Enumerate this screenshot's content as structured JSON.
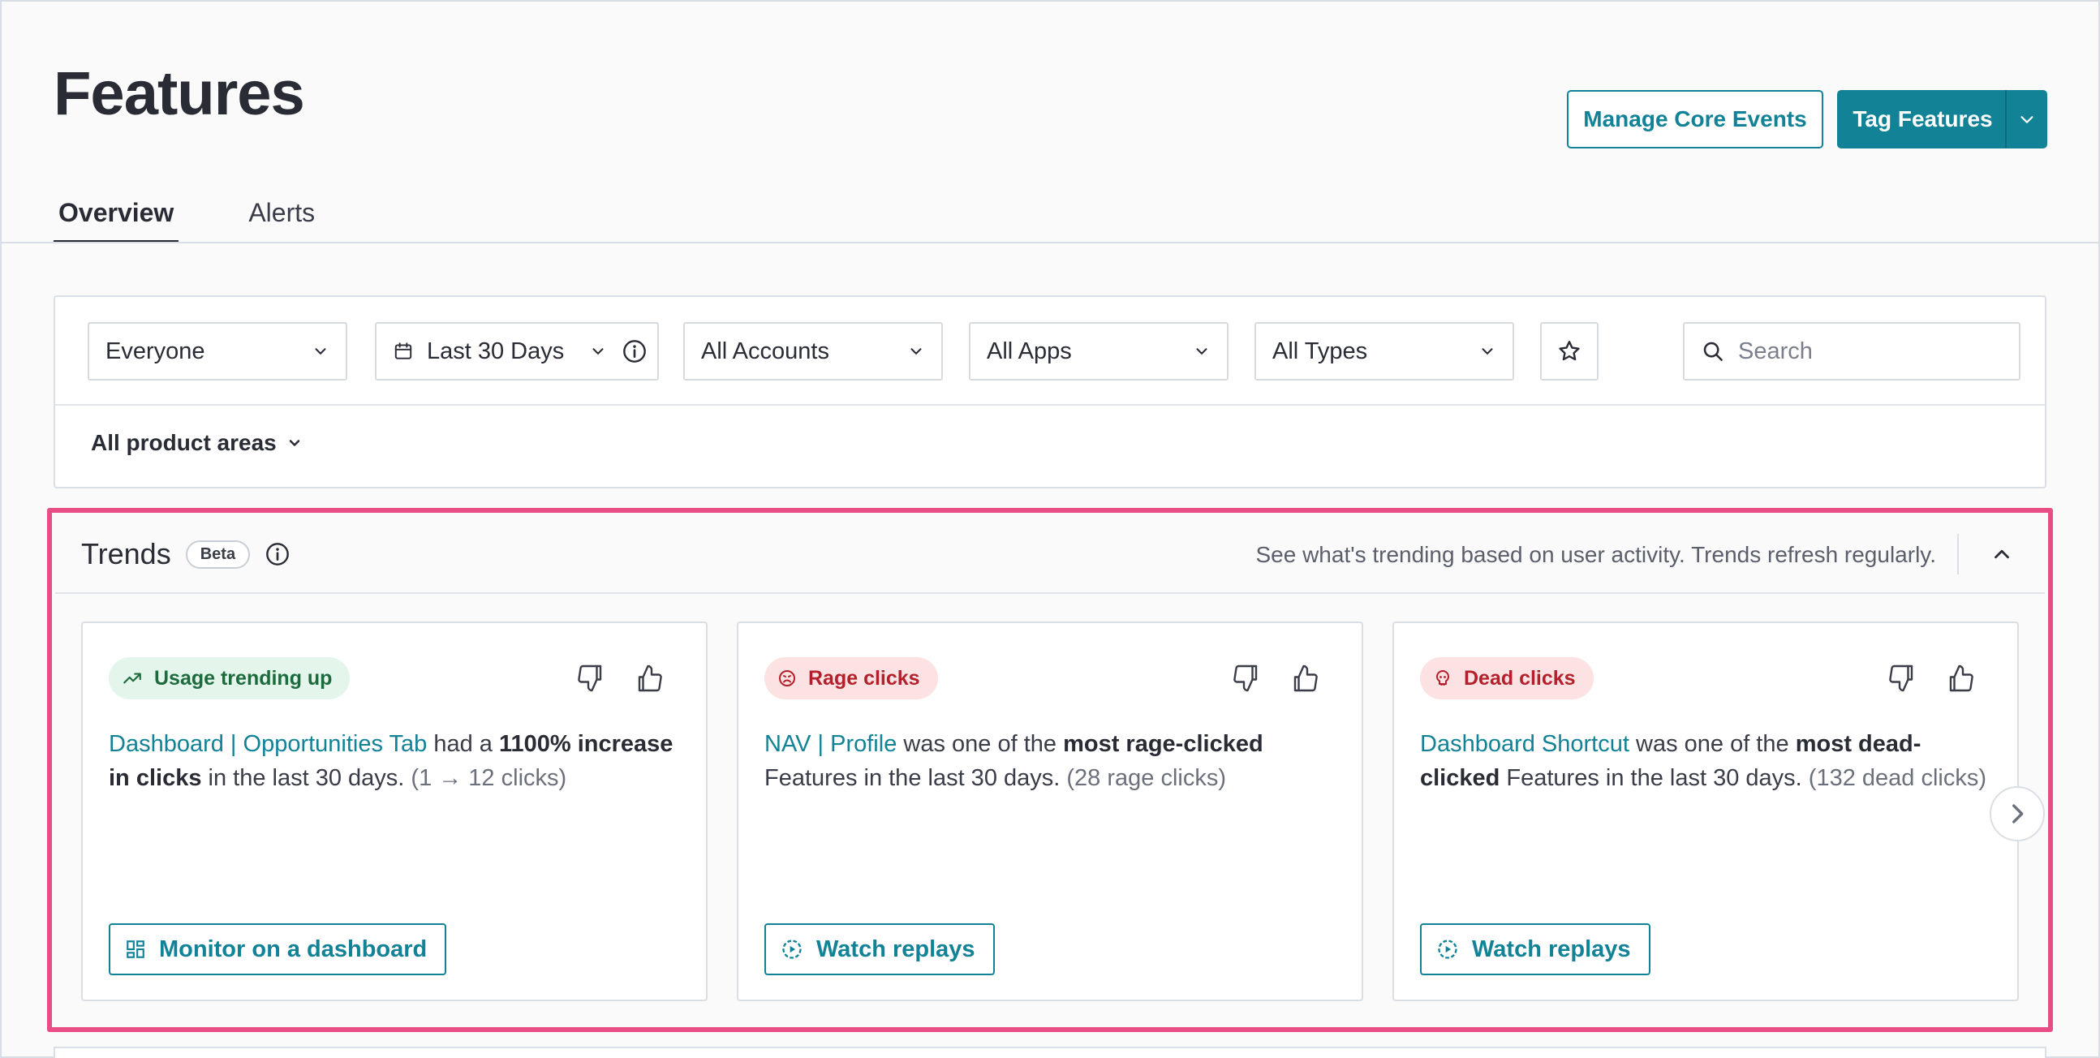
{
  "header": {
    "title": "Features",
    "manage_core_events": "Manage Core Events",
    "tag_features": "Tag Features"
  },
  "tabs": [
    {
      "label": "Overview",
      "active": true
    },
    {
      "label": "Alerts",
      "active": false
    }
  ],
  "filters": {
    "segment": "Everyone",
    "date_range": "Last 30 Days",
    "accounts": "All Accounts",
    "apps": "All Apps",
    "types": "All Types",
    "search_placeholder": "Search",
    "product_areas": "All product areas"
  },
  "trends": {
    "title": "Trends",
    "beta_label": "Beta",
    "description": "See what's trending based on user activity. Trends refresh regularly.",
    "cards": [
      {
        "badge": "Usage trending up",
        "feature_name": "Dashboard | Opportunities Tab",
        "t1": " had a ",
        "b1": "1100% increase in clicks",
        "t2": " in the last 30 days. ",
        "detail": "(1 → 12 clicks)",
        "button": "Monitor on a dashboard"
      },
      {
        "badge": "Rage clicks",
        "feature_name": "NAV | Profile",
        "t1": " was one of the ",
        "b1": "most rage-clicked",
        "t2": " Features in the last 30 days. ",
        "detail": "(28 rage clicks)",
        "button": "Watch replays"
      },
      {
        "badge": "Dead clicks",
        "feature_name": "Dashboard Shortcut",
        "t1": " was one of the ",
        "b1": "most dead-clicked",
        "t2": " Features in the last 30 days. ",
        "detail": "(132 dead clicks)",
        "button": "Watch replays"
      }
    ]
  },
  "colors": {
    "accent": "#128297",
    "highlight": "#e84d86",
    "trend_up_bg": "#e4f6ec",
    "rage_bg": "#fde2e3"
  }
}
